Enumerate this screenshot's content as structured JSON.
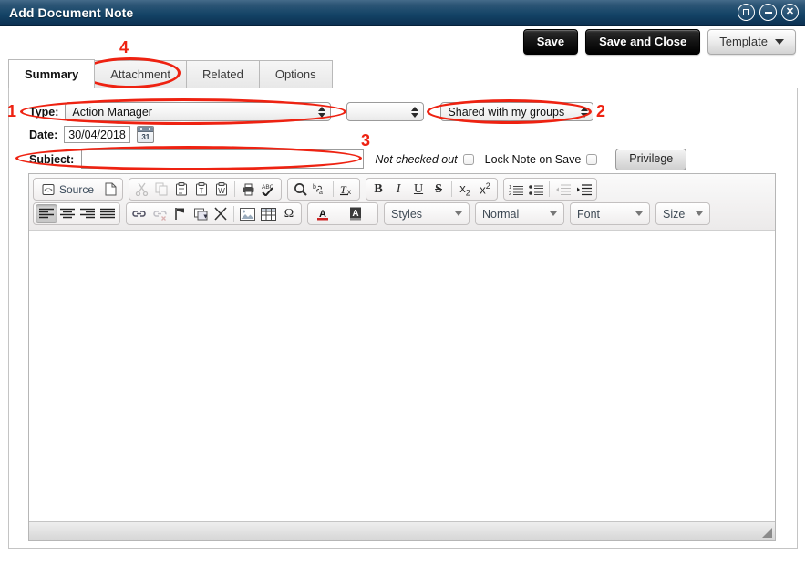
{
  "window": {
    "title": "Add Document Note",
    "controls": [
      {
        "name": "maximize-button",
        "glyph": "square"
      },
      {
        "name": "minimize-button",
        "glyph": "dash"
      },
      {
        "name": "close-button",
        "glyph": "X"
      }
    ]
  },
  "toolbar_actions": {
    "save_label": "Save",
    "save_and_close_label": "Save and Close",
    "template_label": "Template"
  },
  "tabs": [
    {
      "label": "Summary",
      "active": true
    },
    {
      "label": "Attachment",
      "active": false
    },
    {
      "label": "Related",
      "active": false
    },
    {
      "label": "Options",
      "active": false
    }
  ],
  "form": {
    "type_label": "Type:",
    "type_value": "Action Manager",
    "type_secondary_value": "",
    "sharing_value": "Shared with my groups",
    "date_label": "Date:",
    "date_value": "30/04/2018",
    "calendar_icon_number": "31",
    "subject_label": "Subject:",
    "subject_value": "",
    "not_checked_out_label": "Not checked out",
    "lock_note_label": "Lock Note on Save",
    "privilege_label": "Privilege"
  },
  "editor": {
    "source_label": "Source",
    "styles_label": "Styles",
    "format_label": "Normal",
    "font_label": "Font",
    "size_label": "Size",
    "body_value": "",
    "toolbar_row1": [
      {
        "name": "source-button",
        "label": "Source"
      },
      {
        "name": "new-page-icon",
        "label": ""
      },
      {
        "name": "cut-icon",
        "label": "",
        "disabled": true
      },
      {
        "name": "copy-icon",
        "label": "",
        "disabled": true
      },
      {
        "name": "paste-icon",
        "label": ""
      },
      {
        "name": "paste-as-plain-text-icon",
        "label": ""
      },
      {
        "name": "paste-from-word-icon",
        "label": ""
      },
      {
        "name": "print-icon",
        "label": ""
      },
      {
        "name": "spell-check-icon",
        "label": ""
      },
      {
        "name": "find-icon",
        "label": ""
      },
      {
        "name": "replace-icon",
        "label": ""
      },
      {
        "name": "remove-format-icon",
        "label": ""
      },
      {
        "name": "bold-icon",
        "label": "B"
      },
      {
        "name": "italic-icon",
        "label": "I"
      },
      {
        "name": "underline-icon",
        "label": "U"
      },
      {
        "name": "strikethrough-icon",
        "label": "S"
      },
      {
        "name": "subscript-icon",
        "label": "x"
      },
      {
        "name": "superscript-icon",
        "label": "x"
      },
      {
        "name": "numbered-list-icon",
        "label": ""
      },
      {
        "name": "bulleted-list-icon",
        "label": ""
      },
      {
        "name": "outdent-icon",
        "label": "",
        "disabled": true
      },
      {
        "name": "indent-icon",
        "label": ""
      }
    ],
    "toolbar_row2": [
      {
        "name": "align-left-icon",
        "label": "",
        "active": true
      },
      {
        "name": "align-center-icon",
        "label": ""
      },
      {
        "name": "align-right-icon",
        "label": ""
      },
      {
        "name": "justify-icon",
        "label": ""
      },
      {
        "name": "link-icon",
        "label": ""
      },
      {
        "name": "unlink-icon",
        "label": "",
        "disabled": true
      },
      {
        "name": "anchor-icon",
        "label": ""
      },
      {
        "name": "iframe-icon",
        "label": ""
      },
      {
        "name": "templates-icon",
        "label": ""
      },
      {
        "name": "image-icon",
        "label": ""
      },
      {
        "name": "table-icon",
        "label": ""
      },
      {
        "name": "special-character-icon",
        "label": "Ω"
      },
      {
        "name": "text-color-icon",
        "label": "A"
      },
      {
        "name": "background-color-icon",
        "label": "A"
      }
    ]
  },
  "annotations": [
    {
      "number": "1",
      "target": "type-row"
    },
    {
      "number": "2",
      "target": "sharing-select"
    },
    {
      "number": "3",
      "target": "subject-field"
    },
    {
      "number": "4",
      "target": "attachment-tab"
    }
  ],
  "colors": {
    "titlebar_dark": "#0d3253",
    "titlebar_light": "#456b8a",
    "annotation_red": "#ee2211",
    "panel_border": "#c4c4c4"
  }
}
